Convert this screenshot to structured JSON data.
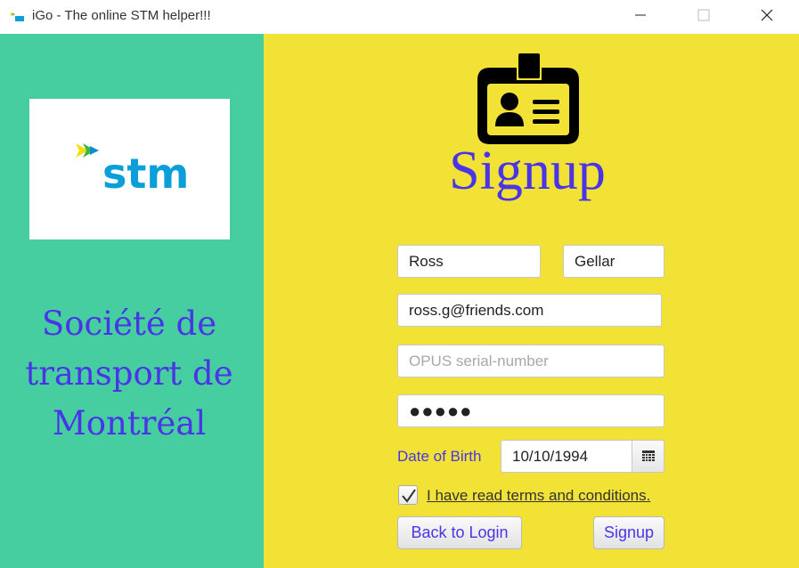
{
  "window": {
    "title": "iGo - The online STM helper!!!"
  },
  "sidebar": {
    "org_name_line1": "Société de",
    "org_name_line2": "transport de",
    "org_name_line3": "Montréal",
    "logo_text": "stm"
  },
  "form": {
    "heading": "Signup",
    "first_name": "Ross",
    "last_name": "Gellar",
    "email": "ross.g@friends.com",
    "opus_placeholder": "OPUS serial-number",
    "password_mask": "●●●●●",
    "dob_label": "Date of Birth",
    "dob_value": "10/10/1994",
    "terms_label": "I have read terms and conditions.",
    "terms_checked": true,
    "back_button": "Back to Login",
    "signup_button": "Signup"
  },
  "colors": {
    "left_panel": "#46cda0",
    "right_panel": "#f2e236",
    "accent": "#4a34e8"
  },
  "icons": {
    "app": "stm-logo-icon",
    "id_card": "id-card-icon",
    "calendar": "calendar-icon",
    "check": "checkmark-icon"
  }
}
